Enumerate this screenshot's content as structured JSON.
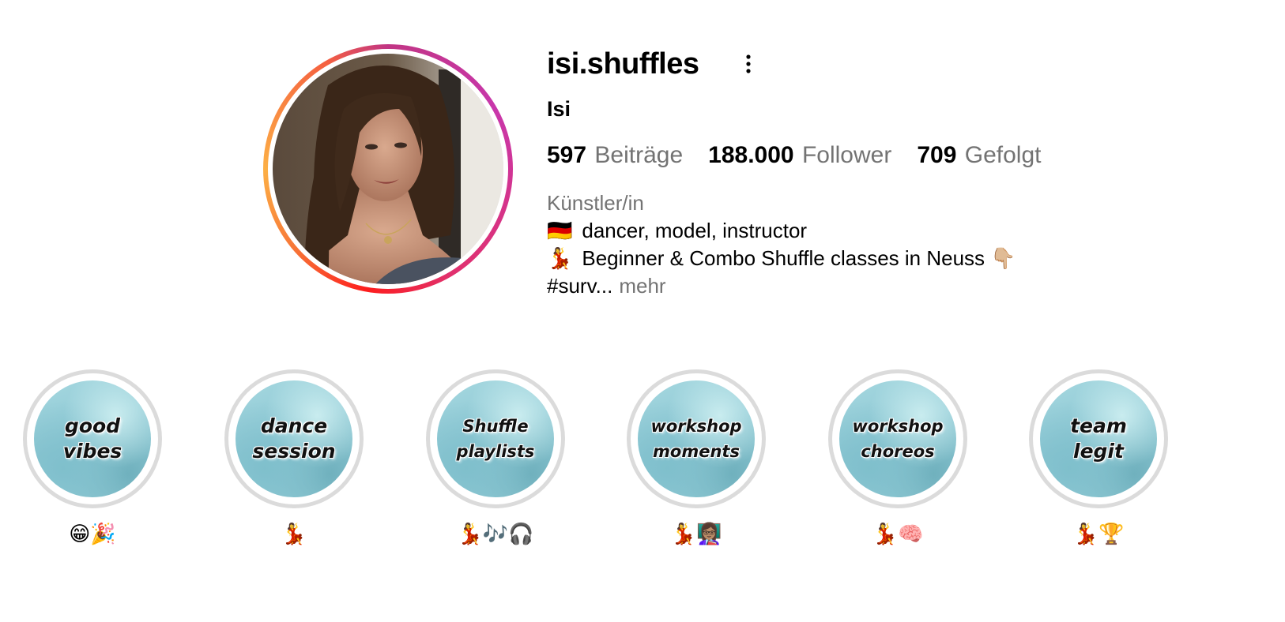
{
  "profile": {
    "username": "isi.shuffles",
    "full_name": "Isi",
    "avatar_icon": "profile-photo",
    "more_icon": "vertical-ellipsis-icon",
    "stats": [
      {
        "count": "597",
        "label": "Beiträge"
      },
      {
        "count": "188.000",
        "label": "Follower"
      },
      {
        "count": "709",
        "label": "Gefolgt"
      }
    ],
    "category": "Künstler/in",
    "bio_lines": [
      {
        "emoji": "🇩🇪",
        "text": "dancer, model, instructor"
      },
      {
        "emoji": "💃",
        "text": "Beginner & Combo Shuffle classes in Neuss 👇🏼"
      }
    ],
    "bio_truncated": "#surv...",
    "more_link": "mehr"
  },
  "highlights": [
    {
      "cover_text": "good\nvibes",
      "label": "😁🎉"
    },
    {
      "cover_text": "dance\nsession",
      "label": "💃"
    },
    {
      "cover_text": "Shuffle\nplaylists",
      "label": "💃🎶🎧"
    },
    {
      "cover_text": "workshop\nmoments",
      "label": "💃👩🏽‍🏫"
    },
    {
      "cover_text": "workshop\nchoreos",
      "label": "💃🧠"
    },
    {
      "cover_text": "team\nlegit",
      "label": "💃🏆"
    }
  ],
  "colors": {
    "story_ring_start": "#c13584",
    "story_ring_end": "#fcaf45",
    "muted_text": "#737373",
    "highlight_ring": "#dbdbdb"
  }
}
